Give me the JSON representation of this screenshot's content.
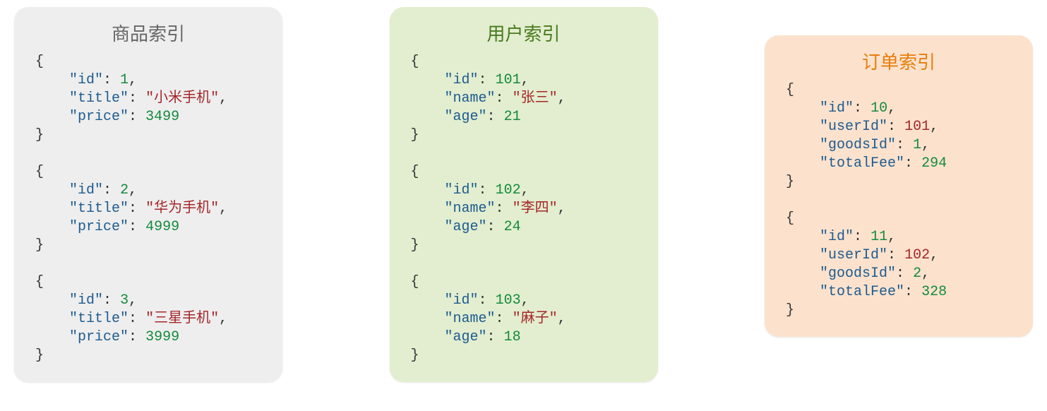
{
  "products": {
    "title": "商品索引",
    "records": [
      {
        "id": 1,
        "title_val": "小米手机",
        "price": 3499
      },
      {
        "id": 2,
        "title_val": "华为手机",
        "price": 4999
      },
      {
        "id": 3,
        "title_val": "三星手机",
        "price": 3999
      }
    ],
    "keys": {
      "id": "\"id\"",
      "title": "\"title\"",
      "price": "\"price\""
    }
  },
  "users": {
    "title": "用户索引",
    "records": [
      {
        "id": 101,
        "name": "张三",
        "age": 21
      },
      {
        "id": 102,
        "name": "李四",
        "age": 24
      },
      {
        "id": 103,
        "name": "麻子",
        "age": 18
      }
    ],
    "keys": {
      "id": "\"id\"",
      "name": "\"name\"",
      "age": "\"age\""
    }
  },
  "orders": {
    "title": "订单索引",
    "records": [
      {
        "id": 10,
        "userId": 101,
        "goodsId": 1,
        "totalFee": 294
      },
      {
        "id": 11,
        "userId": 102,
        "goodsId": 2,
        "totalFee": 328
      }
    ],
    "keys": {
      "id": "\"id\"",
      "userId": "\"userId\"",
      "goodsId": "\"goodsId\"",
      "totalFee": "\"totalFee\""
    }
  },
  "symbols": {
    "open": "{",
    "close": "}",
    "colon": ":",
    "comma": ","
  }
}
